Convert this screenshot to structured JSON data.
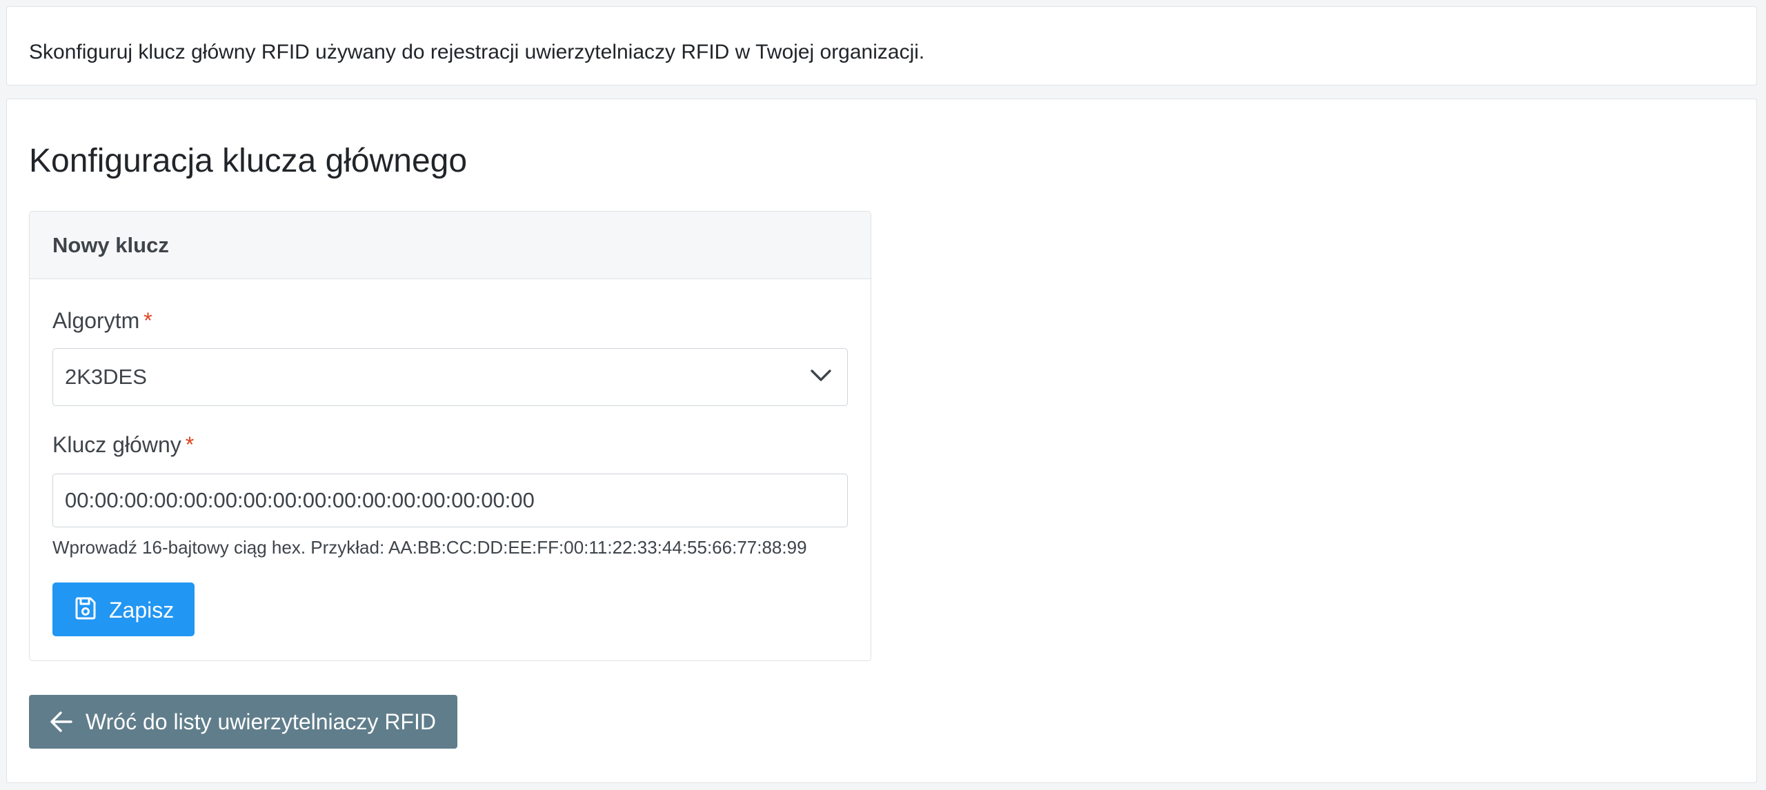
{
  "intro": {
    "description": "Skonfiguruj klucz główny RFID używany do rejestracji uwierzytelniaczy RFID w Twojej organizacji."
  },
  "main": {
    "title": "Konfiguracja klucza głównego",
    "panel": {
      "title": "Nowy klucz",
      "algorithm": {
        "label": "Algorytm",
        "required_mark": "*",
        "selected": "2K3DES",
        "icon": "chevron-down-icon"
      },
      "master_key": {
        "label": "Klucz główny",
        "required_mark": "*",
        "value": "00:00:00:00:00:00:00:00:00:00:00:00:00:00:00:00",
        "help": "Wprowadź 16-bajtowy ciąg hex. Przykład: AA:BB:CC:DD:EE:FF:00:11:22:33:44:55:66:77:88:99"
      },
      "save_button": {
        "label": "Zapisz",
        "icon": "save-icon",
        "color": "#2196f3"
      }
    },
    "back_button": {
      "label": "Wróć do listy uwierzytelniaczy RFID",
      "icon": "arrow-left-icon",
      "color": "#607d8b"
    }
  },
  "colors": {
    "required": "#e0431f",
    "page_background": "#f4f5f7"
  }
}
